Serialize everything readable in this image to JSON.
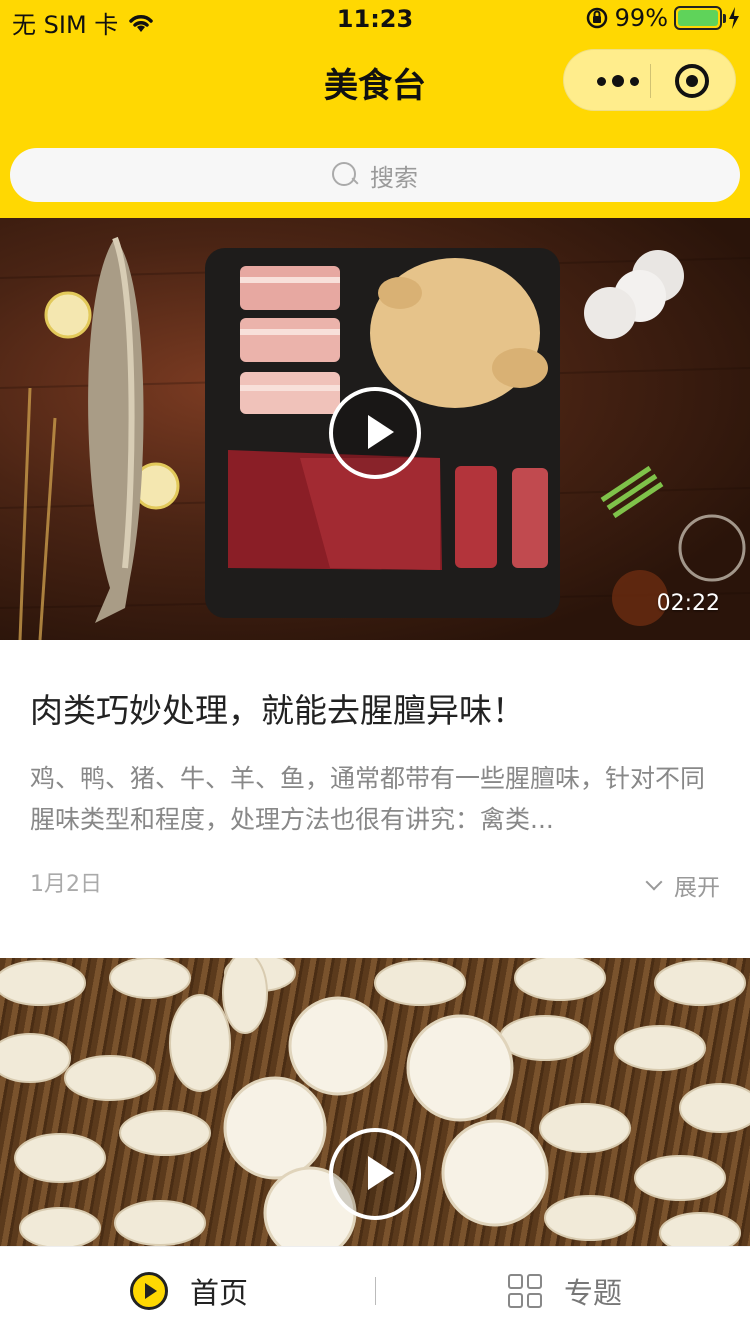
{
  "status_bar": {
    "carrier": "无 SIM 卡",
    "time": "11:23",
    "battery_percent": "99%",
    "battery_level": 0.99,
    "battery_color": "#5fd35a"
  },
  "nav": {
    "title": "美食台",
    "bg_color": "#ffd802"
  },
  "search": {
    "placeholder": "搜索"
  },
  "feed": [
    {
      "duration": "02:22",
      "title": "肉类巧妙处理，就能去腥膻异味！",
      "description": "鸡、鸭、猪、牛、羊、鱼，通常都带有一些腥膻味，针对不同腥味类型和程度，处理方法也很有讲究：禽类...",
      "date": "1月2日",
      "expand_label": "展开"
    },
    {
      "duration": ""
    }
  ],
  "tabbar": {
    "home_label": "首页",
    "topic_label": "专题",
    "active_tab": "首页"
  }
}
